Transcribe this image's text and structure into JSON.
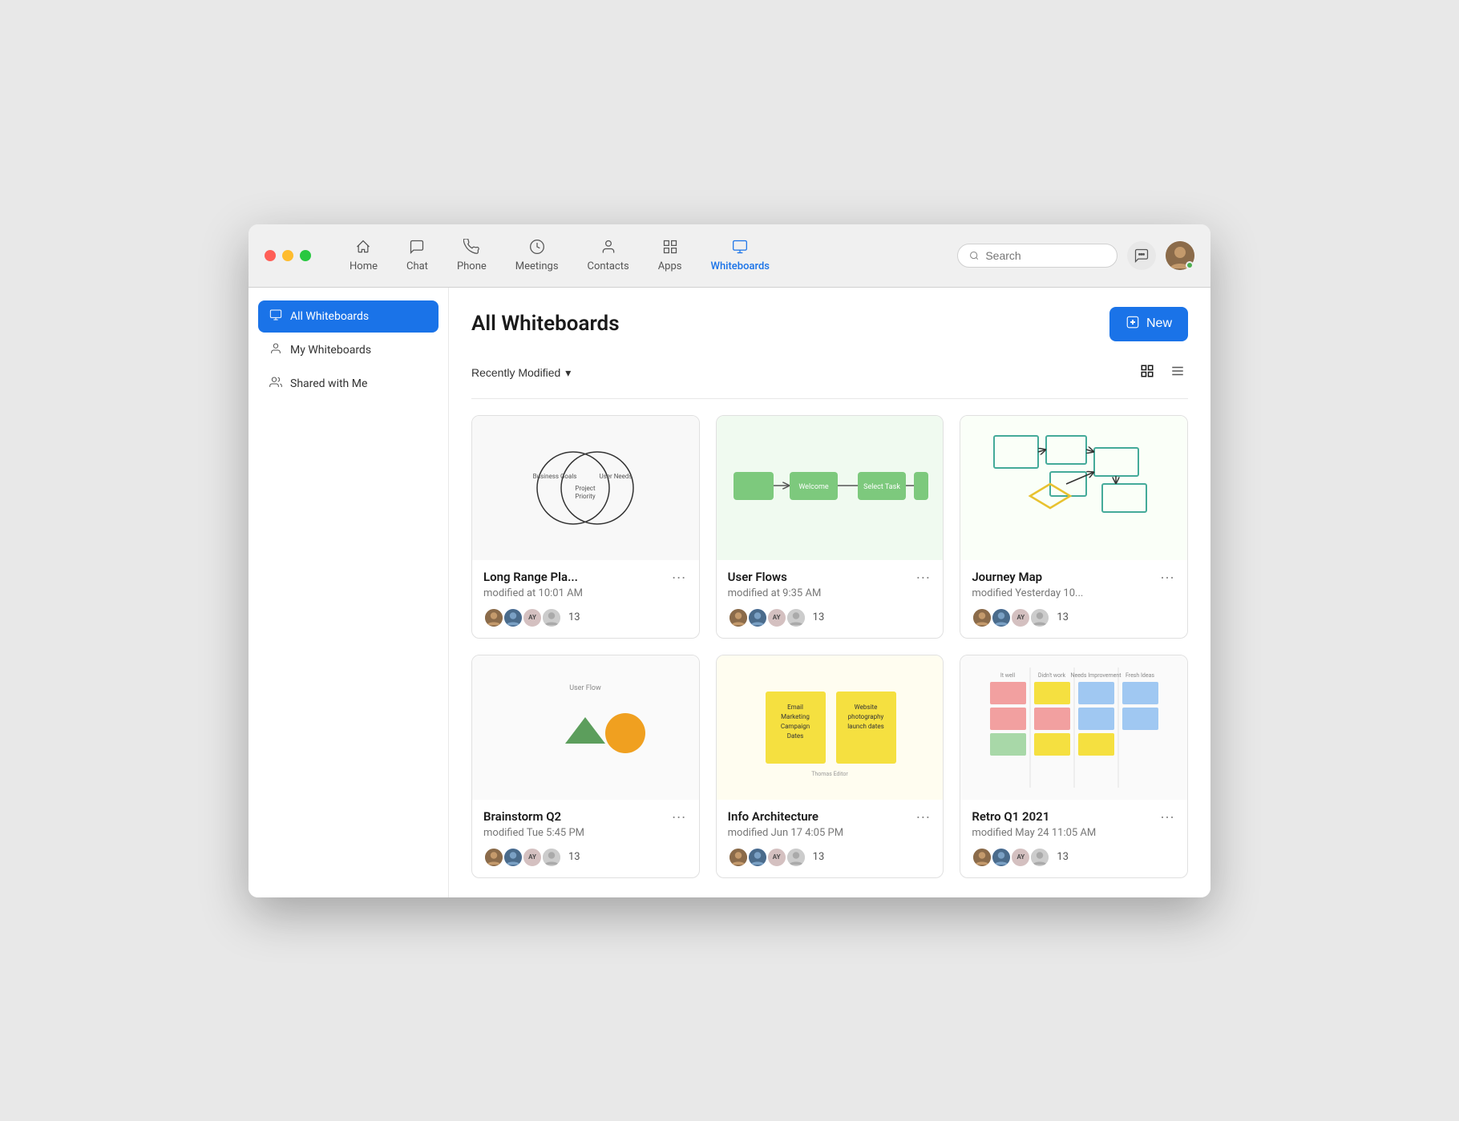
{
  "window": {
    "title": "Whiteboards"
  },
  "nav": {
    "items": [
      {
        "id": "home",
        "label": "Home",
        "icon": "⌂",
        "active": false
      },
      {
        "id": "chat",
        "label": "Chat",
        "icon": "💬",
        "active": false
      },
      {
        "id": "phone",
        "label": "Phone",
        "icon": "📞",
        "active": false
      },
      {
        "id": "meetings",
        "label": "Meetings",
        "icon": "🕐",
        "active": false
      },
      {
        "id": "contacts",
        "label": "Contacts",
        "icon": "👤",
        "active": false
      },
      {
        "id": "apps",
        "label": "Apps",
        "icon": "⊞",
        "active": false
      },
      {
        "id": "whiteboards",
        "label": "Whiteboards",
        "icon": "🖥",
        "active": true
      }
    ],
    "search_placeholder": "Search"
  },
  "sidebar": {
    "items": [
      {
        "id": "all",
        "label": "All Whiteboards",
        "icon": "🖥",
        "active": true
      },
      {
        "id": "my",
        "label": "My Whiteboards",
        "icon": "👤",
        "active": false
      },
      {
        "id": "shared",
        "label": "Shared with Me",
        "icon": "👥",
        "active": false
      }
    ]
  },
  "content": {
    "title": "All Whiteboards",
    "new_button": "New",
    "filter_label": "Recently Modified",
    "whiteboards": [
      {
        "id": "long-range",
        "title": "Long Range Pla...",
        "modified": "modified at 10:01 AM",
        "collaborator_count": "13"
      },
      {
        "id": "user-flows",
        "title": "User Flows",
        "modified": "modified at 9:35 AM",
        "collaborator_count": "13"
      },
      {
        "id": "journey-map",
        "title": "Journey Map",
        "modified": "modified Yesterday 10...",
        "collaborator_count": "13"
      },
      {
        "id": "brainstorm-q2",
        "title": "Brainstorm Q2",
        "modified": "modified Tue 5:45 PM",
        "collaborator_count": "13"
      },
      {
        "id": "info-arch",
        "title": "Info Architecture",
        "modified": "modified Jun 17 4:05 PM",
        "collaborator_count": "13"
      },
      {
        "id": "retro-q1",
        "title": "Retro Q1 2021",
        "modified": "modified May 24 11:05 AM",
        "collaborator_count": "13"
      }
    ]
  }
}
